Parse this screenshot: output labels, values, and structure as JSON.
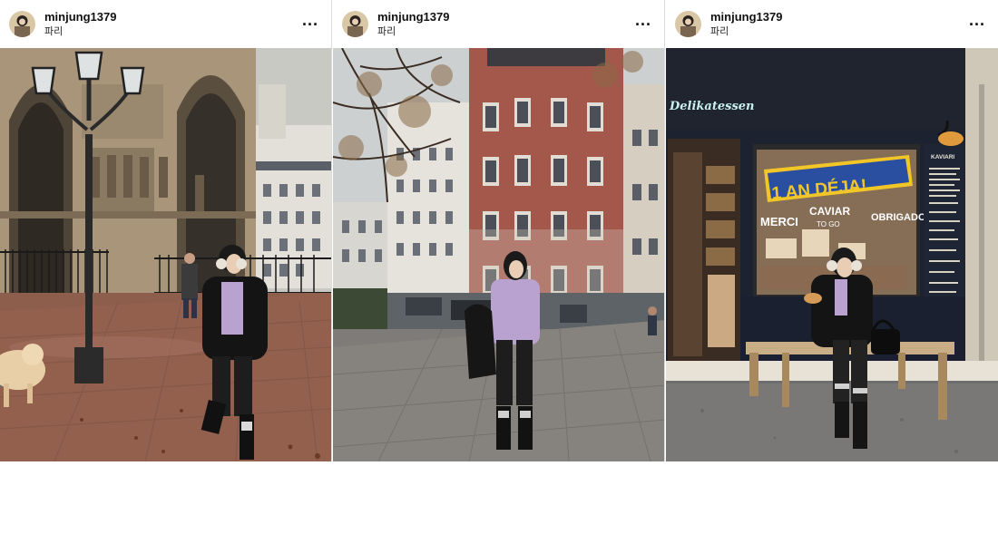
{
  "posts": [
    {
      "username": "minjung1379",
      "location": "파리",
      "more_icon": "more-horizontal-icon",
      "photo": "Gothic church facade with lamp post, woman in black coat and lavender top, white dog, wet brick plaza"
    },
    {
      "username": "minjung1379",
      "location": "파리",
      "more_icon": "more-horizontal-icon",
      "photo": "Parisian street corner with red brick building, bare tree, woman holding black jacket"
    },
    {
      "username": "minjung1379",
      "location": "파리",
      "more_icon": "more-horizontal-icon",
      "photo": "Delicatessen storefront, woman sitting on wooden bench eating pastry",
      "signs": {
        "deli": "Delikatessen",
        "banner": "1 AN DÉJA!",
        "caviar": "CAVIAR",
        "to_go": "TO GO",
        "merci": "MERCI",
        "obrigado": "OBRIGADO",
        "kaviari": "KAVIARI"
      }
    }
  ],
  "colors": {
    "lavender": "#b9a2cf",
    "brick": "#a4574b",
    "stone": "#a8957a",
    "storefront": "#1d2230",
    "banner_yellow": "#f3c628",
    "banner_blue": "#2a4fa0"
  }
}
